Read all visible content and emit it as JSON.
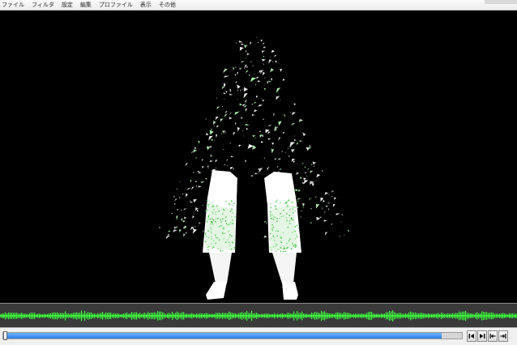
{
  "menu": {
    "items": [
      {
        "id": "file",
        "label": "ファイル"
      },
      {
        "id": "filter",
        "label": "フィルタ"
      },
      {
        "id": "settings",
        "label": "設定"
      },
      {
        "id": "edit",
        "label": "編集"
      },
      {
        "id": "profile",
        "label": "プロファイル"
      },
      {
        "id": "view",
        "label": "表示"
      },
      {
        "id": "other",
        "label": "その他"
      }
    ]
  },
  "playback": {
    "progress": 0.955
  },
  "controls": {
    "icons": [
      "prev-frame-icon",
      "next-frame-icon",
      "jump-start-icon",
      "jump-end-icon"
    ]
  },
  "colors": {
    "waveform": "#3cff3c",
    "seek_fill": "#2b7fe8",
    "background": "#000000"
  }
}
